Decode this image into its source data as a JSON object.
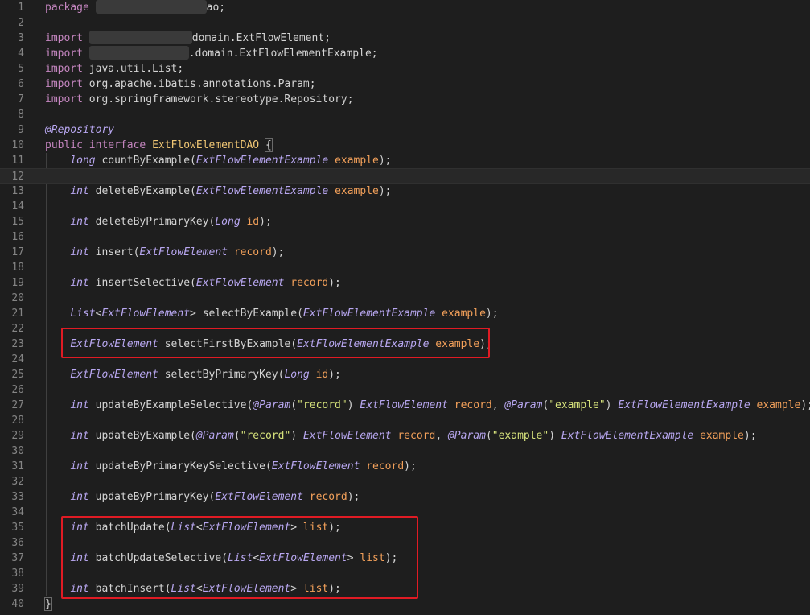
{
  "editor": {
    "colors": {
      "background": "#1e1e1e",
      "highlight_box": "#e01b24"
    },
    "lines": [
      {
        "n": "1",
        "tokens": [
          [
            "kw",
            "package"
          ],
          [
            "plain",
            " "
          ],
          [
            "redact",
            ""
          ],
          [
            "plain",
            "ao;"
          ]
        ]
      },
      {
        "n": "2",
        "tokens": []
      },
      {
        "n": "3",
        "tokens": [
          [
            "kw",
            "import"
          ],
          [
            "plain",
            " "
          ],
          [
            "redact",
            ""
          ],
          [
            "plain",
            "domain.ExtFlowElement;"
          ]
        ]
      },
      {
        "n": "4",
        "tokens": [
          [
            "kw",
            "import"
          ],
          [
            "plain",
            " "
          ],
          [
            "redact",
            ""
          ],
          [
            "plain",
            ".domain.ExtFlowElementExample;"
          ]
        ]
      },
      {
        "n": "5",
        "tokens": [
          [
            "kw",
            "import"
          ],
          [
            "plain",
            " java.util.List;"
          ]
        ]
      },
      {
        "n": "6",
        "tokens": [
          [
            "kw",
            "import"
          ],
          [
            "plain",
            " org.apache.ibatis.annotations.Param;"
          ]
        ]
      },
      {
        "n": "7",
        "tokens": [
          [
            "kw",
            "import"
          ],
          [
            "plain",
            " org.springframework.stereotype.Repository;"
          ]
        ]
      },
      {
        "n": "8",
        "tokens": []
      },
      {
        "n": "9",
        "tokens": [
          [
            "ann",
            "@Repository"
          ]
        ]
      },
      {
        "n": "10",
        "tokens": [
          [
            "kw",
            "public"
          ],
          [
            "plain",
            " "
          ],
          [
            "kw",
            "interface"
          ],
          [
            "plain",
            " "
          ],
          [
            "cls",
            "ExtFlowElementDAO"
          ],
          [
            "plain",
            " "
          ],
          [
            "brace",
            "{"
          ]
        ]
      },
      {
        "n": "11",
        "tokens": [
          [
            "plain",
            "    "
          ],
          [
            "kwtype",
            "long"
          ],
          [
            "plain",
            " "
          ],
          [
            "fn",
            "countByExample"
          ],
          [
            "punc",
            "("
          ],
          [
            "type",
            "ExtFlowElementExample"
          ],
          [
            "plain",
            " "
          ],
          [
            "param",
            "example"
          ],
          [
            "punc",
            ");"
          ]
        ]
      },
      {
        "n": "12",
        "tokens": [],
        "current": true
      },
      {
        "n": "13",
        "tokens": [
          [
            "plain",
            "    "
          ],
          [
            "kwtype",
            "int"
          ],
          [
            "plain",
            " "
          ],
          [
            "fn",
            "deleteByExample"
          ],
          [
            "punc",
            "("
          ],
          [
            "type",
            "ExtFlowElementExample"
          ],
          [
            "plain",
            " "
          ],
          [
            "param",
            "example"
          ],
          [
            "punc",
            ");"
          ]
        ]
      },
      {
        "n": "14",
        "tokens": []
      },
      {
        "n": "15",
        "tokens": [
          [
            "plain",
            "    "
          ],
          [
            "kwtype",
            "int"
          ],
          [
            "plain",
            " "
          ],
          [
            "fn",
            "deleteByPrimaryKey"
          ],
          [
            "punc",
            "("
          ],
          [
            "type",
            "Long"
          ],
          [
            "plain",
            " "
          ],
          [
            "param",
            "id"
          ],
          [
            "punc",
            ");"
          ]
        ]
      },
      {
        "n": "16",
        "tokens": []
      },
      {
        "n": "17",
        "tokens": [
          [
            "plain",
            "    "
          ],
          [
            "kwtype",
            "int"
          ],
          [
            "plain",
            " "
          ],
          [
            "fn",
            "insert"
          ],
          [
            "punc",
            "("
          ],
          [
            "type",
            "ExtFlowElement"
          ],
          [
            "plain",
            " "
          ],
          [
            "param",
            "record"
          ],
          [
            "punc",
            ");"
          ]
        ]
      },
      {
        "n": "18",
        "tokens": []
      },
      {
        "n": "19",
        "tokens": [
          [
            "plain",
            "    "
          ],
          [
            "kwtype",
            "int"
          ],
          [
            "plain",
            " "
          ],
          [
            "fn",
            "insertSelective"
          ],
          [
            "punc",
            "("
          ],
          [
            "type",
            "ExtFlowElement"
          ],
          [
            "plain",
            " "
          ],
          [
            "param",
            "record"
          ],
          [
            "punc",
            ");"
          ]
        ]
      },
      {
        "n": "20",
        "tokens": []
      },
      {
        "n": "21",
        "tokens": [
          [
            "plain",
            "    "
          ],
          [
            "type",
            "List"
          ],
          [
            "punc",
            "<"
          ],
          [
            "type",
            "ExtFlowElement"
          ],
          [
            "punc",
            ">"
          ],
          [
            "plain",
            " "
          ],
          [
            "fn",
            "selectByExample"
          ],
          [
            "punc",
            "("
          ],
          [
            "type",
            "ExtFlowElementExample"
          ],
          [
            "plain",
            " "
          ],
          [
            "param",
            "example"
          ],
          [
            "punc",
            ");"
          ]
        ]
      },
      {
        "n": "22",
        "tokens": []
      },
      {
        "n": "23",
        "tokens": [
          [
            "plain",
            "    "
          ],
          [
            "type",
            "ExtFlowElement"
          ],
          [
            "plain",
            " "
          ],
          [
            "fn",
            "selectFirstByExample"
          ],
          [
            "punc",
            "("
          ],
          [
            "type",
            "ExtFlowElementExample"
          ],
          [
            "plain",
            " "
          ],
          [
            "param",
            "example"
          ],
          [
            "punc",
            ");"
          ]
        ]
      },
      {
        "n": "24",
        "tokens": []
      },
      {
        "n": "25",
        "tokens": [
          [
            "plain",
            "    "
          ],
          [
            "type",
            "ExtFlowElement"
          ],
          [
            "plain",
            " "
          ],
          [
            "fn",
            "selectByPrimaryKey"
          ],
          [
            "punc",
            "("
          ],
          [
            "type",
            "Long"
          ],
          [
            "plain",
            " "
          ],
          [
            "param",
            "id"
          ],
          [
            "punc",
            ");"
          ]
        ]
      },
      {
        "n": "26",
        "tokens": []
      },
      {
        "n": "27",
        "tokens": [
          [
            "plain",
            "    "
          ],
          [
            "kwtype",
            "int"
          ],
          [
            "plain",
            " "
          ],
          [
            "fn",
            "updateByExampleSelective"
          ],
          [
            "punc",
            "("
          ],
          [
            "ann",
            "@Param"
          ],
          [
            "punc",
            "("
          ],
          [
            "str",
            "\"record\""
          ],
          [
            "punc",
            ")"
          ],
          [
            "plain",
            " "
          ],
          [
            "type",
            "ExtFlowElement"
          ],
          [
            "plain",
            " "
          ],
          [
            "param",
            "record"
          ],
          [
            "punc",
            ","
          ],
          [
            "plain",
            " "
          ],
          [
            "ann",
            "@Param"
          ],
          [
            "punc",
            "("
          ],
          [
            "str",
            "\"example\""
          ],
          [
            "punc",
            ")"
          ],
          [
            "plain",
            " "
          ],
          [
            "type",
            "ExtFlowElementExample"
          ],
          [
            "plain",
            " "
          ],
          [
            "param",
            "example"
          ],
          [
            "punc",
            ");"
          ]
        ]
      },
      {
        "n": "28",
        "tokens": []
      },
      {
        "n": "29",
        "tokens": [
          [
            "plain",
            "    "
          ],
          [
            "kwtype",
            "int"
          ],
          [
            "plain",
            " "
          ],
          [
            "fn",
            "updateByExample"
          ],
          [
            "punc",
            "("
          ],
          [
            "ann",
            "@Param"
          ],
          [
            "punc",
            "("
          ],
          [
            "str",
            "\"record\""
          ],
          [
            "punc",
            ")"
          ],
          [
            "plain",
            " "
          ],
          [
            "type",
            "ExtFlowElement"
          ],
          [
            "plain",
            " "
          ],
          [
            "param",
            "record"
          ],
          [
            "punc",
            ","
          ],
          [
            "plain",
            " "
          ],
          [
            "ann",
            "@Param"
          ],
          [
            "punc",
            "("
          ],
          [
            "str",
            "\"example\""
          ],
          [
            "punc",
            ")"
          ],
          [
            "plain",
            " "
          ],
          [
            "type",
            "ExtFlowElementExample"
          ],
          [
            "plain",
            " "
          ],
          [
            "param",
            "example"
          ],
          [
            "punc",
            ");"
          ]
        ]
      },
      {
        "n": "30",
        "tokens": []
      },
      {
        "n": "31",
        "tokens": [
          [
            "plain",
            "    "
          ],
          [
            "kwtype",
            "int"
          ],
          [
            "plain",
            " "
          ],
          [
            "fn",
            "updateByPrimaryKeySelective"
          ],
          [
            "punc",
            "("
          ],
          [
            "type",
            "ExtFlowElement"
          ],
          [
            "plain",
            " "
          ],
          [
            "param",
            "record"
          ],
          [
            "punc",
            ");"
          ]
        ]
      },
      {
        "n": "32",
        "tokens": []
      },
      {
        "n": "33",
        "tokens": [
          [
            "plain",
            "    "
          ],
          [
            "kwtype",
            "int"
          ],
          [
            "plain",
            " "
          ],
          [
            "fn",
            "updateByPrimaryKey"
          ],
          [
            "punc",
            "("
          ],
          [
            "type",
            "ExtFlowElement"
          ],
          [
            "plain",
            " "
          ],
          [
            "param",
            "record"
          ],
          [
            "punc",
            ");"
          ]
        ]
      },
      {
        "n": "34",
        "tokens": []
      },
      {
        "n": "35",
        "tokens": [
          [
            "plain",
            "    "
          ],
          [
            "kwtype",
            "int"
          ],
          [
            "plain",
            " "
          ],
          [
            "fn",
            "batchUpdate"
          ],
          [
            "punc",
            "("
          ],
          [
            "type",
            "List"
          ],
          [
            "punc",
            "<"
          ],
          [
            "type",
            "ExtFlowElement"
          ],
          [
            "punc",
            ">"
          ],
          [
            "plain",
            " "
          ],
          [
            "param",
            "list"
          ],
          [
            "punc",
            ");"
          ]
        ]
      },
      {
        "n": "36",
        "tokens": []
      },
      {
        "n": "37",
        "tokens": [
          [
            "plain",
            "    "
          ],
          [
            "kwtype",
            "int"
          ],
          [
            "plain",
            " "
          ],
          [
            "fn",
            "batchUpdateSelective"
          ],
          [
            "punc",
            "("
          ],
          [
            "type",
            "List"
          ],
          [
            "punc",
            "<"
          ],
          [
            "type",
            "ExtFlowElement"
          ],
          [
            "punc",
            ">"
          ],
          [
            "plain",
            " "
          ],
          [
            "param",
            "list"
          ],
          [
            "punc",
            ");"
          ]
        ]
      },
      {
        "n": "38",
        "tokens": []
      },
      {
        "n": "39",
        "tokens": [
          [
            "plain",
            "    "
          ],
          [
            "kwtype",
            "int"
          ],
          [
            "plain",
            " "
          ],
          [
            "fn",
            "batchInsert"
          ],
          [
            "punc",
            "("
          ],
          [
            "type",
            "List"
          ],
          [
            "punc",
            "<"
          ],
          [
            "type",
            "ExtFlowElement"
          ],
          [
            "punc",
            ">"
          ],
          [
            "plain",
            " "
          ],
          [
            "param",
            "list"
          ],
          [
            "punc",
            ");"
          ]
        ]
      },
      {
        "n": "40",
        "tokens": [
          [
            "brace",
            "}"
          ]
        ]
      }
    ]
  }
}
